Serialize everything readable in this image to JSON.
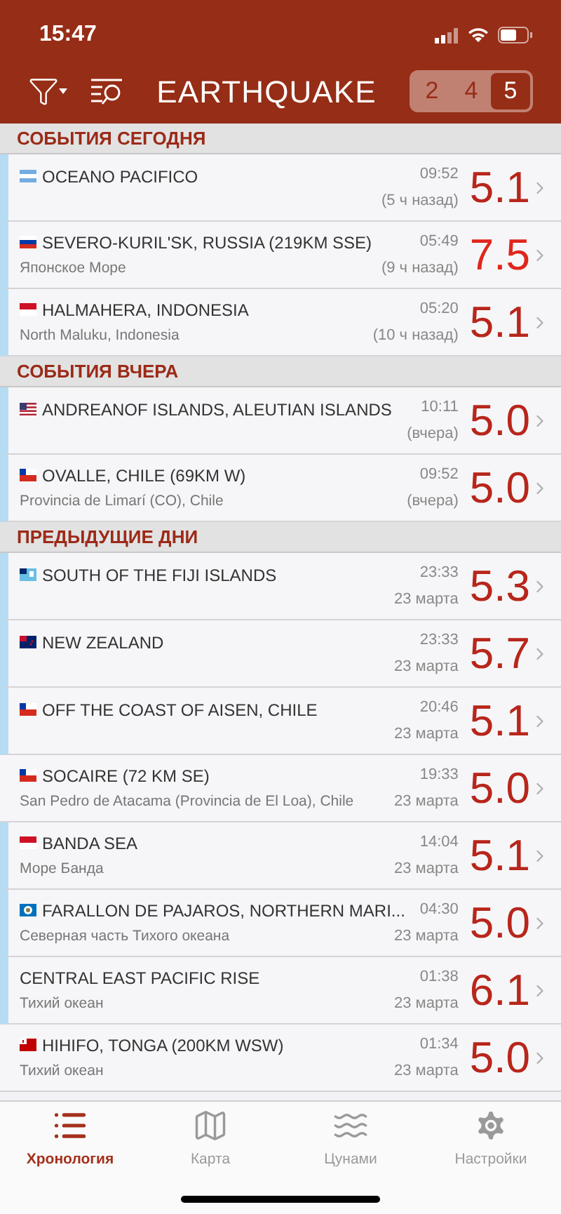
{
  "status_bar": {
    "time": "15:47"
  },
  "header": {
    "title": "EARTHQUAKE",
    "magnitude_filter": [
      {
        "label": "2",
        "selected": false
      },
      {
        "label": "4",
        "selected": false
      },
      {
        "label": "5",
        "selected": true
      }
    ]
  },
  "sections": [
    {
      "title": "СОБЫТИЯ СЕГОДНЯ",
      "events": [
        {
          "kind": "ar",
          "place": "OCEANO PACIFICO",
          "time": "09:52",
          "when": "(5 ч назад)",
          "magnitude": "5.1",
          "color": "#b8261b",
          "new": true
        },
        {
          "kind": "ru",
          "place": "SEVERO-KURIL'SK, RUSSIA (219KM SSE)",
          "region": "Японское Море",
          "time": "05:49",
          "when": "(9 ч назад)",
          "magnitude": "7.5",
          "color": "#e0261c",
          "new": true
        },
        {
          "kind": "id",
          "place": "HALMAHERA, INDONESIA",
          "region": "North Maluku, Indonesia",
          "time": "05:20",
          "when": "(10 ч назад)",
          "magnitude": "5.1",
          "color": "#b8261b",
          "new": true
        }
      ]
    },
    {
      "title": "СОБЫТИЯ ВЧЕРА",
      "events": [
        {
          "kind": "us",
          "place": "ANDREANOF ISLANDS, ALEUTIAN ISLANDS",
          "time": "10:11",
          "when": "(вчера)",
          "magnitude": "5.0",
          "color": "#b8261b",
          "new": true
        },
        {
          "kind": "cl",
          "place": "OVALLE, CHILE (69KM W)",
          "region": "Provincia de Limarí (CO), Chile",
          "time": "09:52",
          "when": "(вчера)",
          "magnitude": "5.0",
          "color": "#b8261b",
          "new": true
        }
      ]
    },
    {
      "title": "ПРЕДЫДУЩИЕ ДНИ",
      "events": [
        {
          "kind": "fj",
          "place": "SOUTH OF THE FIJI ISLANDS",
          "time": "23:33",
          "when": "23 марта",
          "magnitude": "5.3",
          "color": "#b8261b",
          "new": true
        },
        {
          "kind": "nz",
          "place": "NEW ZEALAND",
          "time": "23:33",
          "when": "23 марта",
          "magnitude": "5.7",
          "color": "#b8261b",
          "new": true
        },
        {
          "kind": "cl",
          "place": "OFF THE COAST OF AISEN, CHILE",
          "time": "20:46",
          "when": "23 марта",
          "magnitude": "5.1",
          "color": "#b8261b",
          "new": true
        },
        {
          "kind": "cl",
          "place": "SOCAIRE (72 KM SE)",
          "region": "San Pedro de Atacama (Provincia de El Loa), Chile",
          "time": "19:33",
          "when": "23 марта",
          "magnitude": "5.0",
          "color": "#b8261b",
          "new": false
        },
        {
          "kind": "id",
          "place": "BANDA SEA",
          "region": "Море Банда",
          "time": "14:04",
          "when": "23 марта",
          "magnitude": "5.1",
          "color": "#b8261b",
          "new": true
        },
        {
          "kind": "mp",
          "place": "FARALLON DE PAJAROS, NORTHERN MARI...",
          "region": "Северная часть Тихого океана",
          "time": "04:30",
          "when": "23 марта",
          "magnitude": "5.0",
          "color": "#b8261b",
          "new": true
        },
        {
          "kind": "none",
          "place": "CENTRAL EAST PACIFIC RISE",
          "region": "Тихий океан",
          "time": "01:38",
          "when": "23 марта",
          "magnitude": "6.1",
          "color": "#b8261b",
          "new": true
        },
        {
          "kind": "to",
          "place": "HIHIFO, TONGA (200KM WSW)",
          "region": "Тихий океан",
          "time": "01:34",
          "when": "23 марта",
          "magnitude": "5.0",
          "color": "#b8261b",
          "new": false
        }
      ]
    }
  ],
  "tab_bar": [
    {
      "kind": "list",
      "label": "Хронология",
      "selected": true
    },
    {
      "kind": "map",
      "label": "Карта",
      "selected": false
    },
    {
      "kind": "waves",
      "label": "Цунами",
      "selected": false
    },
    {
      "kind": "gear",
      "label": "Настройки",
      "selected": false
    }
  ]
}
